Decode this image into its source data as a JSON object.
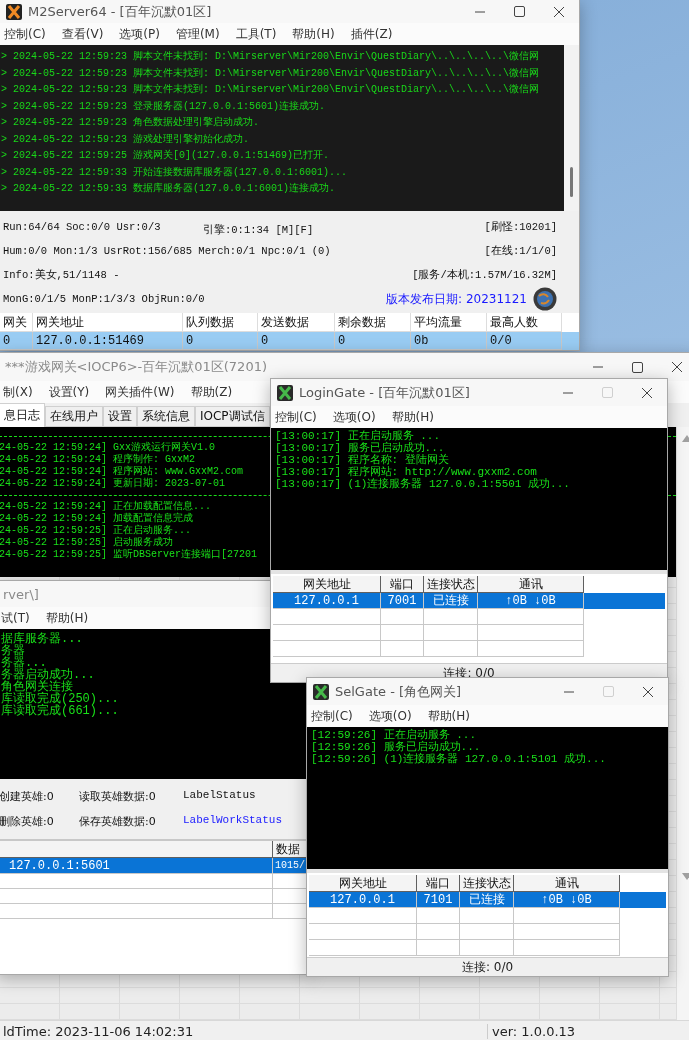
{
  "m2server": {
    "title": "M2Server64 - [百年沉默01区]",
    "menu": [
      "控制(C)",
      "查看(V)",
      "选项(P)",
      "管理(M)",
      "工具(T)",
      "帮助(H)",
      "插件(Z)"
    ],
    "log": [
      "> 2024-05-22 12:59:23 脚本文件未找到: D:\\Mirserver\\Mir200\\Envir\\QuestDiary\\..\\..\\..\\..\\微信网",
      "> 2024-05-22 12:59:23 脚本文件未找到: D:\\Mirserver\\Mir200\\Envir\\QuestDiary\\..\\..\\..\\..\\微信网",
      "> 2024-05-22 12:59:23 脚本文件未找到: D:\\Mirserver\\Mir200\\Envir\\QuestDiary\\..\\..\\..\\..\\微信网",
      "> 2024-05-22 12:59:23 登录服务器(127.0.0.1:5601)连接成功.",
      "> 2024-05-22 12:59:23 角色数据处理引擎启动成功.",
      "> 2024-05-22 12:59:23 游戏处理引擎初始化成功.",
      "> 2024-05-22 12:59:25 游戏网关[0](127.0.0.1:51469)已打开.",
      "> 2024-05-22 12:59:33 开始连接数据库服务器(127.0.0.1:6001)...",
      "> 2024-05-22 12:59:33 数据库服务器(127.0.0.1:6001)连接成功."
    ],
    "stats": [
      {
        "left": "Run:64/64 Soc:0/0 Usr:0/3",
        "center": "引擎:0:1:34 [M][F]",
        "right": "[刷怪:10201]",
        "kind": "plain"
      },
      {
        "left": "Hum:0/0 Mon:1/3 UsrRot:156/685 Merch:0/1 Npc:0/1 (0)",
        "right": "[在线:1/1/0]",
        "kind": "plain"
      },
      {
        "left": "Info:美女,51/1148 -",
        "right": "[服务/本机:1.57M/16.32M]",
        "kind": "plain"
      },
      {
        "left": "MonG:0/1/5 MonP:1/3/3 ObjRun:0/0",
        "right": "版本发布日期: 20231121",
        "kind": "release"
      }
    ],
    "table": {
      "columns": [
        "网关",
        "网关地址",
        "队列数据",
        "发送数据",
        "剩余数据",
        "平均流量",
        "最高人数"
      ],
      "rows": [
        {
          "cells": [
            "0",
            "127.0.0.1:51469",
            "0",
            "0",
            "0",
            "0b",
            "0/0"
          ],
          "selected": true
        }
      ]
    }
  },
  "game_gate": {
    "title": "***游戏网关<IOCP6>-百年沉默01区(7201)",
    "menu": [
      "制(X)",
      "设置(Y)",
      "网关插件(W)",
      "帮助(Z)"
    ],
    "tabs": [
      {
        "label": "息日志",
        "selected": true
      },
      {
        "label": "在线用户",
        "selected": false
      },
      {
        "label": "设置",
        "selected": false
      },
      {
        "label": "系统信息",
        "selected": false
      },
      {
        "label": "IOCP调试信",
        "selected": false
      }
    ],
    "log_sections": [
      [
        "24-05-22 12:59:24] Gxx游戏运行网关V1.0",
        "24-05-22 12:59:24] 程序制作: GxxM2",
        "24-05-22 12:59:24] 程序网站: www.GxxM2.com",
        "24-05-22 12:59:24] 更新日期: 2023-07-01"
      ],
      [
        "24-05-22 12:59:24] 正在加载配置信息...",
        "24-05-22 12:59:24] 加载配置信息完成",
        "24-05-22 12:59:25] 正在启动服务...",
        "24-05-22 12:59:25] 启动服务成功",
        "24-05-22 12:59:25] 监听DBServer连接端口[27201"
      ]
    ],
    "build_time": "ldTime:  2023-11-06 14:02:31",
    "version": "ver:  1.0.0.13"
  },
  "db_server": {
    "title": "rver\\]",
    "menu": [
      "试(T)",
      "帮助(H)"
    ],
    "log": [
      "据库服务器...",
      "务器",
      "务器...",
      "务器启动成功...",
      "角色网关连接",
      "库读取完成(250)...",
      "库读取完成(661)..."
    ],
    "labels": [
      [
        {
          "text": "创建英雄:0",
          "kind": "plain"
        },
        {
          "text": "读取英雄数据:0",
          "kind": "plain"
        },
        {
          "text": "LabelStatus",
          "kind": "plain"
        }
      ],
      [
        {
          "text": "删除英雄:0",
          "kind": "plain"
        },
        {
          "text": "保存英雄数据:0",
          "kind": "plain"
        },
        {
          "text": "LabelWorkStatus",
          "kind": "highlight"
        }
      ]
    ],
    "table": {
      "columns": [
        "",
        "数据"
      ],
      "rows": [
        {
          "cells": [
            "127.0.0.1:5601",
            "1015/"
          ],
          "selected": true
        }
      ]
    }
  },
  "login_gate": {
    "title": "LoginGate - [百年沉默01区]",
    "menu": [
      "控制(C)",
      "选项(O)",
      "帮助(H)"
    ],
    "log": [
      "[13:00:17] 正在启动服务 ...",
      "[13:00:17] 服务已启动成功...",
      "[13:00:17] 程序名称: 登陆网关",
      "[13:00:17] 程序网站: http://www.gxxm2.com",
      "[13:00:17] (1)连接服务器 127.0.0.1:5501 成功..."
    ],
    "table": {
      "columns": [
        "网关地址",
        "端口",
        "连接状态",
        "通讯"
      ],
      "rows": [
        {
          "cells": [
            "127.0.0.1",
            "7001",
            "已连接",
            "↑0B  ↓0B"
          ],
          "selected": true
        }
      ]
    },
    "status": "连接: 0/0"
  },
  "sel_gate": {
    "title": "SelGate - [角色网关]",
    "menu": [
      "控制(C)",
      "选项(O)",
      "帮助(H)"
    ],
    "log": [
      "[12:59:26] 正在启动服务 ...",
      "[12:59:26] 服务已启动成功...",
      "[12:59:26] (1)连接服务器 127.0.0.1:5101 成功..."
    ],
    "table": {
      "columns": [
        "网关地址",
        "端口",
        "连接状态",
        "通讯"
      ],
      "rows": [
        {
          "cells": [
            "127.0.0.1",
            "7101",
            "已连接",
            "↑0B  ↓0B"
          ],
          "selected": true
        }
      ]
    },
    "status": "连接: 0/0"
  }
}
